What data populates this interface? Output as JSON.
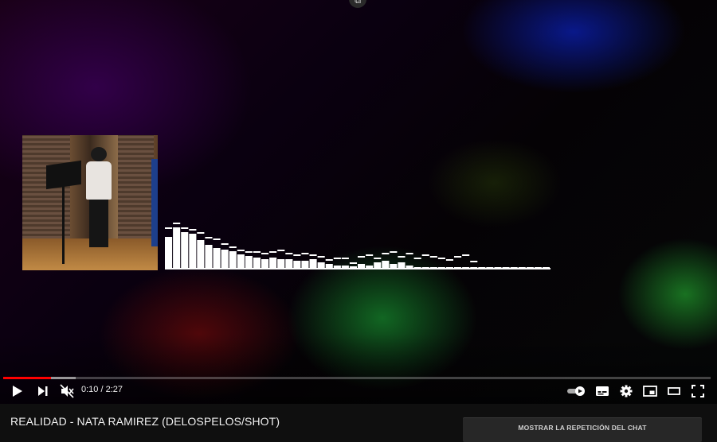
{
  "video": {
    "title": "REALIDAD - NATA RAMIREZ (DELOSPELOS/SHOT)",
    "current_time": "0:10",
    "duration": "2:27",
    "time_display": "0:10 / 2:27",
    "progress_fraction": 0.068,
    "buffered_fraction": 0.103,
    "muted": true,
    "autoplay_on": true
  },
  "controls": {
    "play_icon": "play-icon",
    "next_icon": "next-icon",
    "volume_icon": "volume-muted-icon",
    "autoplay_icon": "autoplay-toggle-icon",
    "captions_icon": "captions-icon",
    "settings_icon": "gear-icon",
    "miniplayer_icon": "miniplayer-icon",
    "theater_icon": "theater-mode-icon",
    "fullscreen_icon": "fullscreen-icon"
  },
  "chat": {
    "replay_label": "MOSTRAR LA REPETICIÓN DEL CHAT"
  },
  "colors": {
    "progress_played": "#ff0000",
    "page_bg": "#0f0f0f",
    "chat_button_bg": "#272727"
  },
  "visualizer": {
    "bars": [
      40,
      52,
      46,
      44,
      36,
      30,
      26,
      24,
      22,
      18,
      16,
      14,
      12,
      14,
      12,
      12,
      10,
      10,
      12,
      8,
      6,
      4,
      4,
      3,
      6,
      4,
      8,
      10,
      6,
      8,
      4,
      2,
      2,
      2,
      2,
      2,
      2,
      2,
      2,
      2,
      2,
      2,
      2,
      2,
      2,
      2,
      2,
      2
    ],
    "peaks": [
      50,
      56,
      50,
      48,
      44,
      38,
      36,
      30,
      26,
      22,
      20,
      20,
      18,
      20,
      22,
      18,
      16,
      18,
      16,
      14,
      10,
      12,
      12,
      6,
      14,
      16,
      12,
      18,
      20,
      14,
      18,
      12,
      16,
      14,
      12,
      10,
      14,
      16,
      8,
      0,
      0,
      0,
      0,
      0,
      0,
      0,
      0,
      0
    ]
  }
}
